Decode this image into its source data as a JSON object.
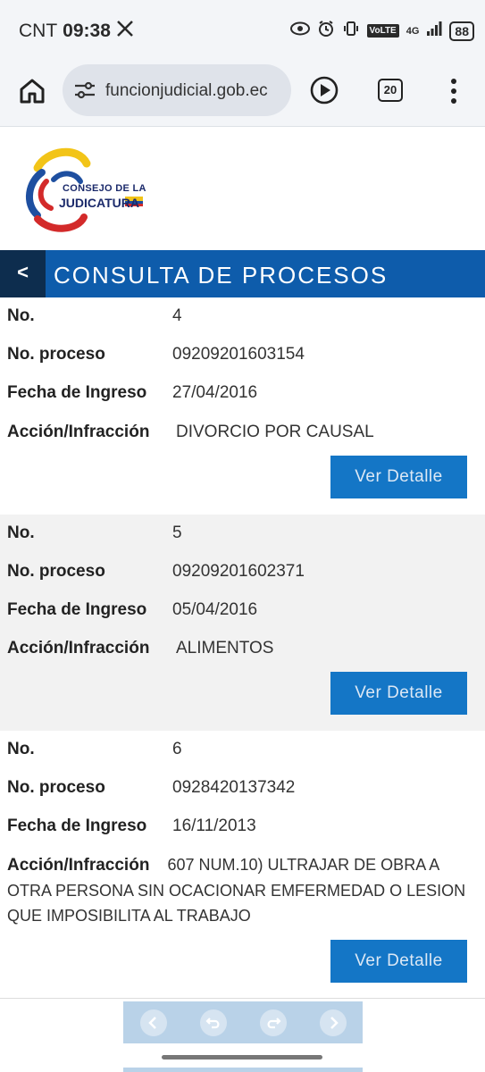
{
  "status_bar": {
    "carrier": "CNT",
    "time": "09:38",
    "volte": "VoLTE",
    "network": "4G",
    "battery": "88"
  },
  "browser": {
    "url": "funcionjudicial.gob.ec",
    "tab_count": "20"
  },
  "logo": {
    "line1": "CONSEJO DE LA",
    "line2": "JUDICATURA"
  },
  "header": {
    "back_label": "<",
    "title": "CONSULTA DE PROCESOS"
  },
  "labels": {
    "no": "No.",
    "proceso": "No. proceso",
    "fecha": "Fecha de Ingreso",
    "accion": "Acción/Infracción",
    "detalle": "Ver Detalle"
  },
  "records": [
    {
      "no": "4",
      "proceso": "09209201603154",
      "fecha": "27/04/2016",
      "accion": "DIVORCIO POR CAUSAL"
    },
    {
      "no": "5",
      "proceso": "09209201602371",
      "fecha": "05/04/2016",
      "accion": "ALIMENTOS"
    },
    {
      "no": "6",
      "proceso": "0928420137342",
      "fecha": "16/11/2013",
      "accion": "607 NUM.10) ULTRAJAR DE OBRA A OTRA PERSONA SIN OCACIONAR EMFERMEDAD O LESION QUE IMPOSIBILITA AL TRABAJO"
    }
  ],
  "colors": {
    "header_blue": "#0e5cab",
    "back_navy": "#0d2d4e",
    "button_blue": "#1476c6",
    "pager_blue": "#b9d2e8"
  }
}
